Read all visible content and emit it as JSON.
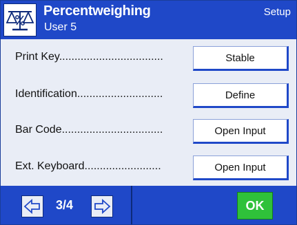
{
  "header": {
    "title": "Percentweighing",
    "subtitle": "User 5",
    "mode": "Setup",
    "icon": "balance-scale-percent-icon"
  },
  "settings": [
    {
      "label": "Print Key..................................",
      "value": "Stable"
    },
    {
      "label": "Identification............................",
      "value": "Define"
    },
    {
      "label": "Bar Code.................................",
      "value": "Open Input"
    },
    {
      "label": "Ext. Keyboard.........................",
      "value": "Open Input"
    }
  ],
  "footer": {
    "page": "3/4",
    "prev_icon": "arrow-left-icon",
    "next_icon": "arrow-right-icon",
    "ok_label": "OK"
  },
  "colors": {
    "header_blue": "#1f48c8",
    "content_bg": "#e9edf6",
    "ok_green": "#2fc13a"
  }
}
